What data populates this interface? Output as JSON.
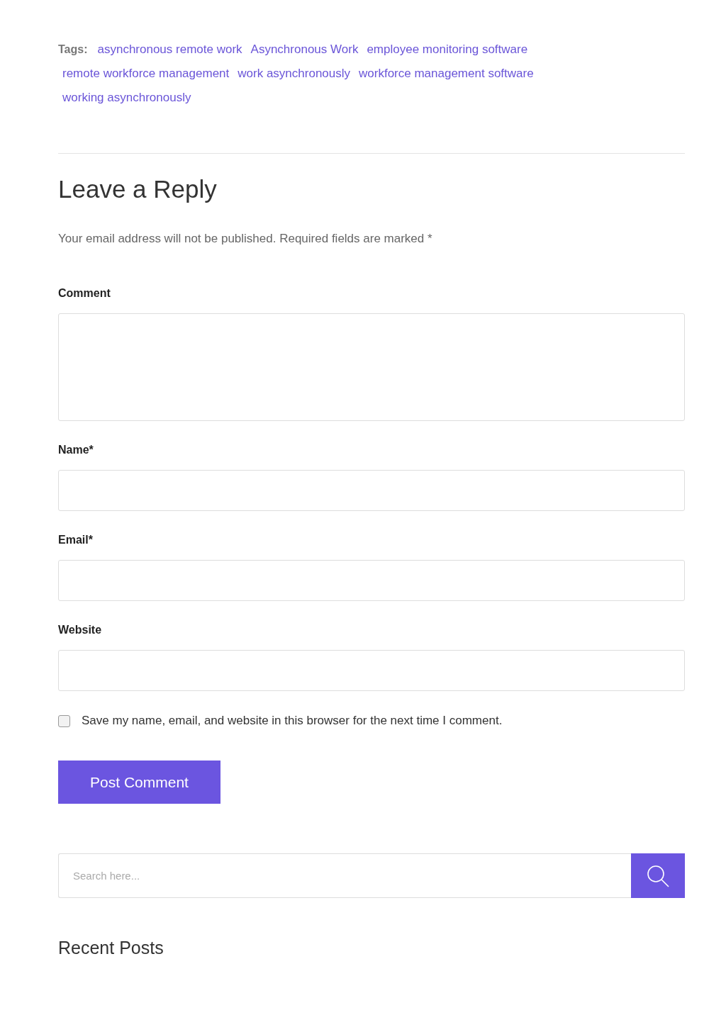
{
  "tags": {
    "label": "Tags:",
    "items": [
      "asynchronous remote work",
      "Asynchronous Work",
      "employee monitoring software",
      "remote workforce management",
      "work asynchronously",
      "workforce management software",
      "working asynchronously"
    ]
  },
  "reply": {
    "title": "Leave a Reply",
    "note": "Your email address will not be published. Required fields are marked *",
    "fields": [
      {
        "kind": "textarea",
        "label": "Comment"
      },
      {
        "kind": "input",
        "label": "Name*"
      },
      {
        "kind": "input",
        "label": "Email*"
      },
      {
        "kind": "input",
        "label": "Website"
      }
    ],
    "consent": {
      "label": "Save my name, email, and website in this browser for the next time I comment.",
      "checked": false
    },
    "submit": "Post Comment"
  },
  "search": {
    "placeholder": "Search here..."
  },
  "recent_posts": {
    "title": "Recent Posts"
  }
}
